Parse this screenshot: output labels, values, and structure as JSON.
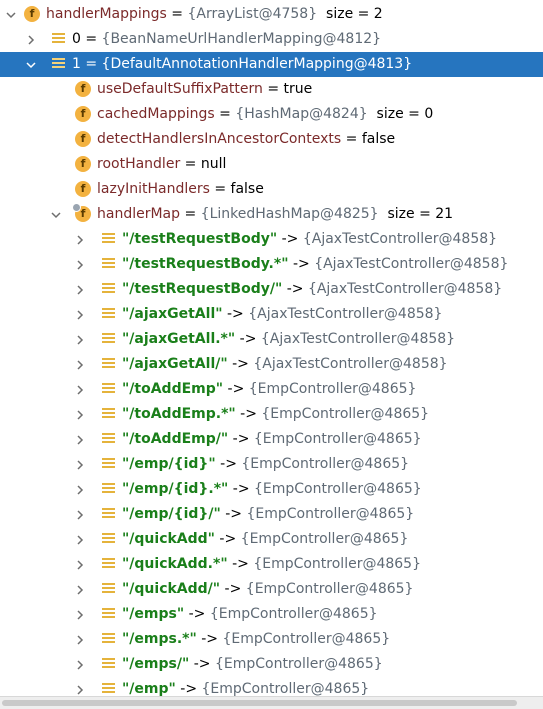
{
  "root": {
    "name": "handlerMappings",
    "eq": " = ",
    "type": "{ArrayList@4758}",
    "size": "size = 2"
  },
  "item0": {
    "label": "0 = ",
    "type": "{BeanNameUrlHandlerMapping@4812}"
  },
  "item1": {
    "label": "1 = {DefaultAnnotationHandlerMapping@4813}"
  },
  "fields": {
    "useDefaultSuffixPattern": {
      "name": "useDefaultSuffixPattern",
      "value": " = true"
    },
    "cachedMappings": {
      "name": "cachedMappings",
      "eq": " = ",
      "type": "{HashMap@4824}",
      "size": "size = 0"
    },
    "detectHandlersInAncestorContexts": {
      "name": "detectHandlersInAncestorContexts",
      "value": " = false"
    },
    "rootHandler": {
      "name": "rootHandler",
      "value": " = null"
    },
    "lazyInitHandlers": {
      "name": "lazyInitHandlers",
      "value": " = false"
    },
    "handlerMap": {
      "name": "handlerMap",
      "eq": " = ",
      "type": "{LinkedHashMap@4825}",
      "size": "size = 21"
    }
  },
  "entries": [
    {
      "key": "\"/testRequestBody\"",
      "arrow": " -> ",
      "value": "{AjaxTestController@4858}"
    },
    {
      "key": "\"/testRequestBody.*\"",
      "arrow": " -> ",
      "value": "{AjaxTestController@4858}"
    },
    {
      "key": "\"/testRequestBody/\"",
      "arrow": " -> ",
      "value": "{AjaxTestController@4858}"
    },
    {
      "key": "\"/ajaxGetAll\"",
      "arrow": " -> ",
      "value": "{AjaxTestController@4858}"
    },
    {
      "key": "\"/ajaxGetAll.*\"",
      "arrow": " -> ",
      "value": "{AjaxTestController@4858}"
    },
    {
      "key": "\"/ajaxGetAll/\"",
      "arrow": " -> ",
      "value": "{AjaxTestController@4858}"
    },
    {
      "key": "\"/toAddEmp\"",
      "arrow": " -> ",
      "value": "{EmpController@4865}"
    },
    {
      "key": "\"/toAddEmp.*\"",
      "arrow": " -> ",
      "value": "{EmpController@4865}"
    },
    {
      "key": "\"/toAddEmp/\"",
      "arrow": " -> ",
      "value": "{EmpController@4865}"
    },
    {
      "key": "\"/emp/{id}\"",
      "arrow": " -> ",
      "value": "{EmpController@4865}"
    },
    {
      "key": "\"/emp/{id}.*\"",
      "arrow": " -> ",
      "value": "{EmpController@4865}"
    },
    {
      "key": "\"/emp/{id}/\"",
      "arrow": " -> ",
      "value": "{EmpController@4865}"
    },
    {
      "key": "\"/quickAdd\"",
      "arrow": " -> ",
      "value": "{EmpController@4865}"
    },
    {
      "key": "\"/quickAdd.*\"",
      "arrow": " -> ",
      "value": "{EmpController@4865}"
    },
    {
      "key": "\"/quickAdd/\"",
      "arrow": " -> ",
      "value": "{EmpController@4865}"
    },
    {
      "key": "\"/emps\"",
      "arrow": " -> ",
      "value": "{EmpController@4865}"
    },
    {
      "key": "\"/emps.*\"",
      "arrow": " -> ",
      "value": "{EmpController@4865}"
    },
    {
      "key": "\"/emps/\"",
      "arrow": " -> ",
      "value": "{EmpController@4865}"
    },
    {
      "key": "\"/emp\"",
      "arrow": " -> ",
      "value": "{EmpController@4865}"
    }
  ],
  "colors": {
    "selection": "#2675bf",
    "field_icon": "#f3b240",
    "entry_icon": "#e5b33b",
    "key_text": "#1a7f1a",
    "field_name": "#7b2a2a",
    "type_text": "#5f6a75"
  }
}
